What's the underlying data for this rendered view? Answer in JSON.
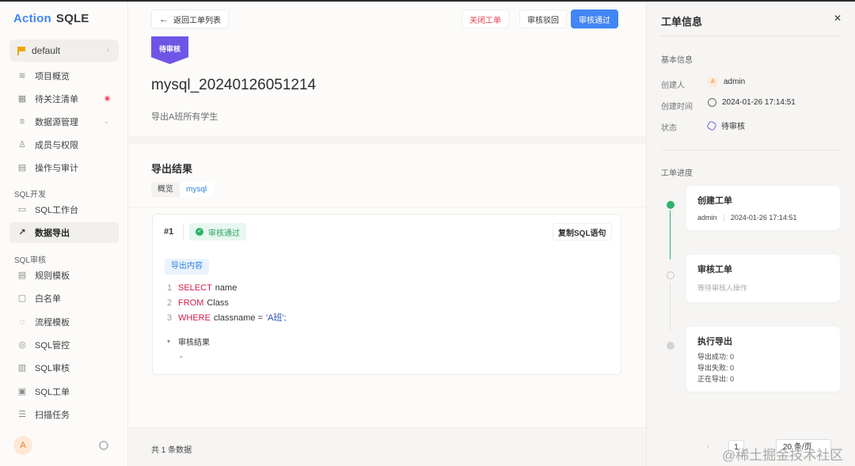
{
  "brand": {
    "part1": "Action",
    "part2": "SQLE"
  },
  "project": {
    "name": "default"
  },
  "sidebar": {
    "items": [
      {
        "label": "项目概览",
        "icon": "layers-icon"
      },
      {
        "label": "待关注清单",
        "icon": "dashboard-icon"
      },
      {
        "label": "数据源管理",
        "icon": "database-icon"
      },
      {
        "label": "成员与权限",
        "icon": "members-icon"
      },
      {
        "label": "操作与审计",
        "icon": "audit-icon"
      }
    ],
    "group_dev": "SQL开发",
    "dev_items": [
      {
        "label": "SQL工作台",
        "icon": "monitor-icon"
      },
      {
        "label": "数据导出",
        "icon": "export-icon"
      }
    ],
    "group_audit": "SQL审核",
    "audit_items": [
      {
        "label": "规则模板",
        "icon": "template-icon"
      },
      {
        "label": "白名单",
        "icon": "whitelist-icon"
      },
      {
        "label": "流程模板",
        "icon": "flow-icon"
      },
      {
        "label": "SQL管控",
        "icon": "control-icon"
      },
      {
        "label": "SQL审核",
        "icon": "review-icon"
      },
      {
        "label": "SQL工单",
        "icon": "ticket-icon"
      },
      {
        "label": "扫描任务",
        "icon": "scan-icon"
      }
    ],
    "avatar_letter": "A"
  },
  "toolbar": {
    "back_label": "返回工单列表",
    "close_label": "关闭工单",
    "reject_label": "审核驳回",
    "approve_label": "审核通过"
  },
  "workorder": {
    "status": "待审核",
    "title": "mysql_20240126051214",
    "description": "导出A班所有学生"
  },
  "export_result": {
    "section_title": "导出结果",
    "tabs": [
      "概览",
      "mysql"
    ],
    "card": {
      "index": "#1",
      "audit_status": "审核通过",
      "copy_label": "复制SQL语句",
      "export_label": "导出内容",
      "code": [
        {
          "n": "1",
          "kw": "SELECT",
          "rest": "name",
          "str": ""
        },
        {
          "n": "2",
          "kw": "FROM",
          "rest": "Class",
          "str": ""
        },
        {
          "n": "3",
          "kw": "WHERE",
          "rest": "classname =",
          "str": "'A班';"
        }
      ],
      "review_title": "审核结果",
      "review_value": "-"
    }
  },
  "footer": {
    "total": "共 1 条数据",
    "page": "1",
    "page_size": "20 条/页"
  },
  "right_panel": {
    "title": "工单信息",
    "basic_title": "基本信息",
    "creator_label": "创建人",
    "creator": "admin",
    "creator_avatar": "A",
    "created_label": "创建时间",
    "created_at": "2024-01-26 17:14:51",
    "status_label": "状态",
    "status": "待审核",
    "progress_title": "工单进度",
    "steps": [
      {
        "title": "创建工单",
        "user": "admin",
        "time": "2024-01-26 17:14:51"
      },
      {
        "title": "审核工单",
        "desc": "等待审核人操作"
      },
      {
        "title": "执行导出",
        "lines": [
          "导出成功: 0",
          "导出失败: 0",
          "正在导出: 0"
        ]
      }
    ]
  },
  "watermark": "@稀土掘金技术社区",
  "colors": {
    "primary": "#4285f4",
    "danger": "#e8434f",
    "success": "#2fb36b",
    "status_purple": "#6f55e6"
  }
}
